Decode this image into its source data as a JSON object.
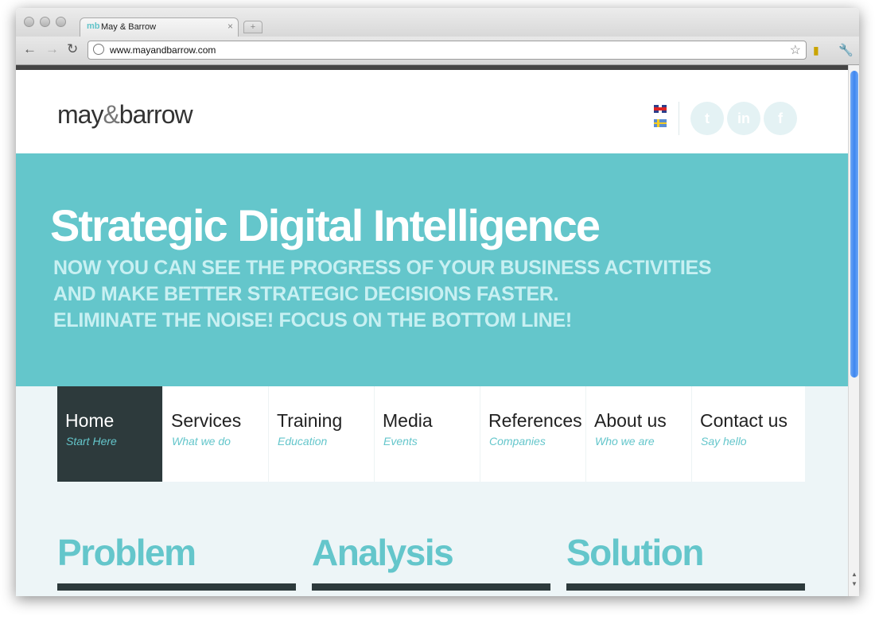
{
  "browser": {
    "tab_title": "May & Barrow",
    "tab_favicon": "mb",
    "tab_close": "×",
    "new_tab": "+",
    "url": "www.mayandbarrow.com",
    "icons": [
      "back-icon",
      "forward-icon",
      "reload-icon",
      "globe-icon",
      "bookmark-star-icon",
      "extension-icon",
      "wrench-icon"
    ]
  },
  "header": {
    "logo_may": "may",
    "logo_amp": "&",
    "logo_barrow": "barrow",
    "languages": [
      "uk-flag-icon",
      "swedish-flag-icon"
    ],
    "social": [
      {
        "name": "twitter-icon",
        "glyph": "t"
      },
      {
        "name": "linkedin-icon",
        "glyph": "in"
      },
      {
        "name": "facebook-icon",
        "glyph": "f"
      }
    ]
  },
  "hero": {
    "title": "Strategic Digital Intelligence",
    "lines": [
      "NOW YOU CAN SEE THE PROGRESS OF YOUR BUSINESS ACTIVITIES",
      "AND MAKE BETTER STRATEGIC DECISIONS FASTER.",
      "ELIMINATE THE NOISE! FOCUS ON THE BOTTOM LINE!"
    ]
  },
  "nav": {
    "items": [
      {
        "label": "Home",
        "sub": "Start Here",
        "active": true
      },
      {
        "label": "Services",
        "sub": "What we do"
      },
      {
        "label": "Training",
        "sub": "Education"
      },
      {
        "label": "Media",
        "sub": "Events"
      },
      {
        "label": "References",
        "sub": "Companies"
      },
      {
        "label": "About us",
        "sub": "Who we are"
      },
      {
        "label": "Contact us",
        "sub": "Say hello"
      }
    ]
  },
  "sections": [
    {
      "title": "Problem"
    },
    {
      "title": "Analysis"
    },
    {
      "title": "Solution"
    }
  ],
  "colors": {
    "accent": "#64c6cb",
    "dark": "#2d3a3c",
    "hero_text_light": "#c8f0f2"
  }
}
